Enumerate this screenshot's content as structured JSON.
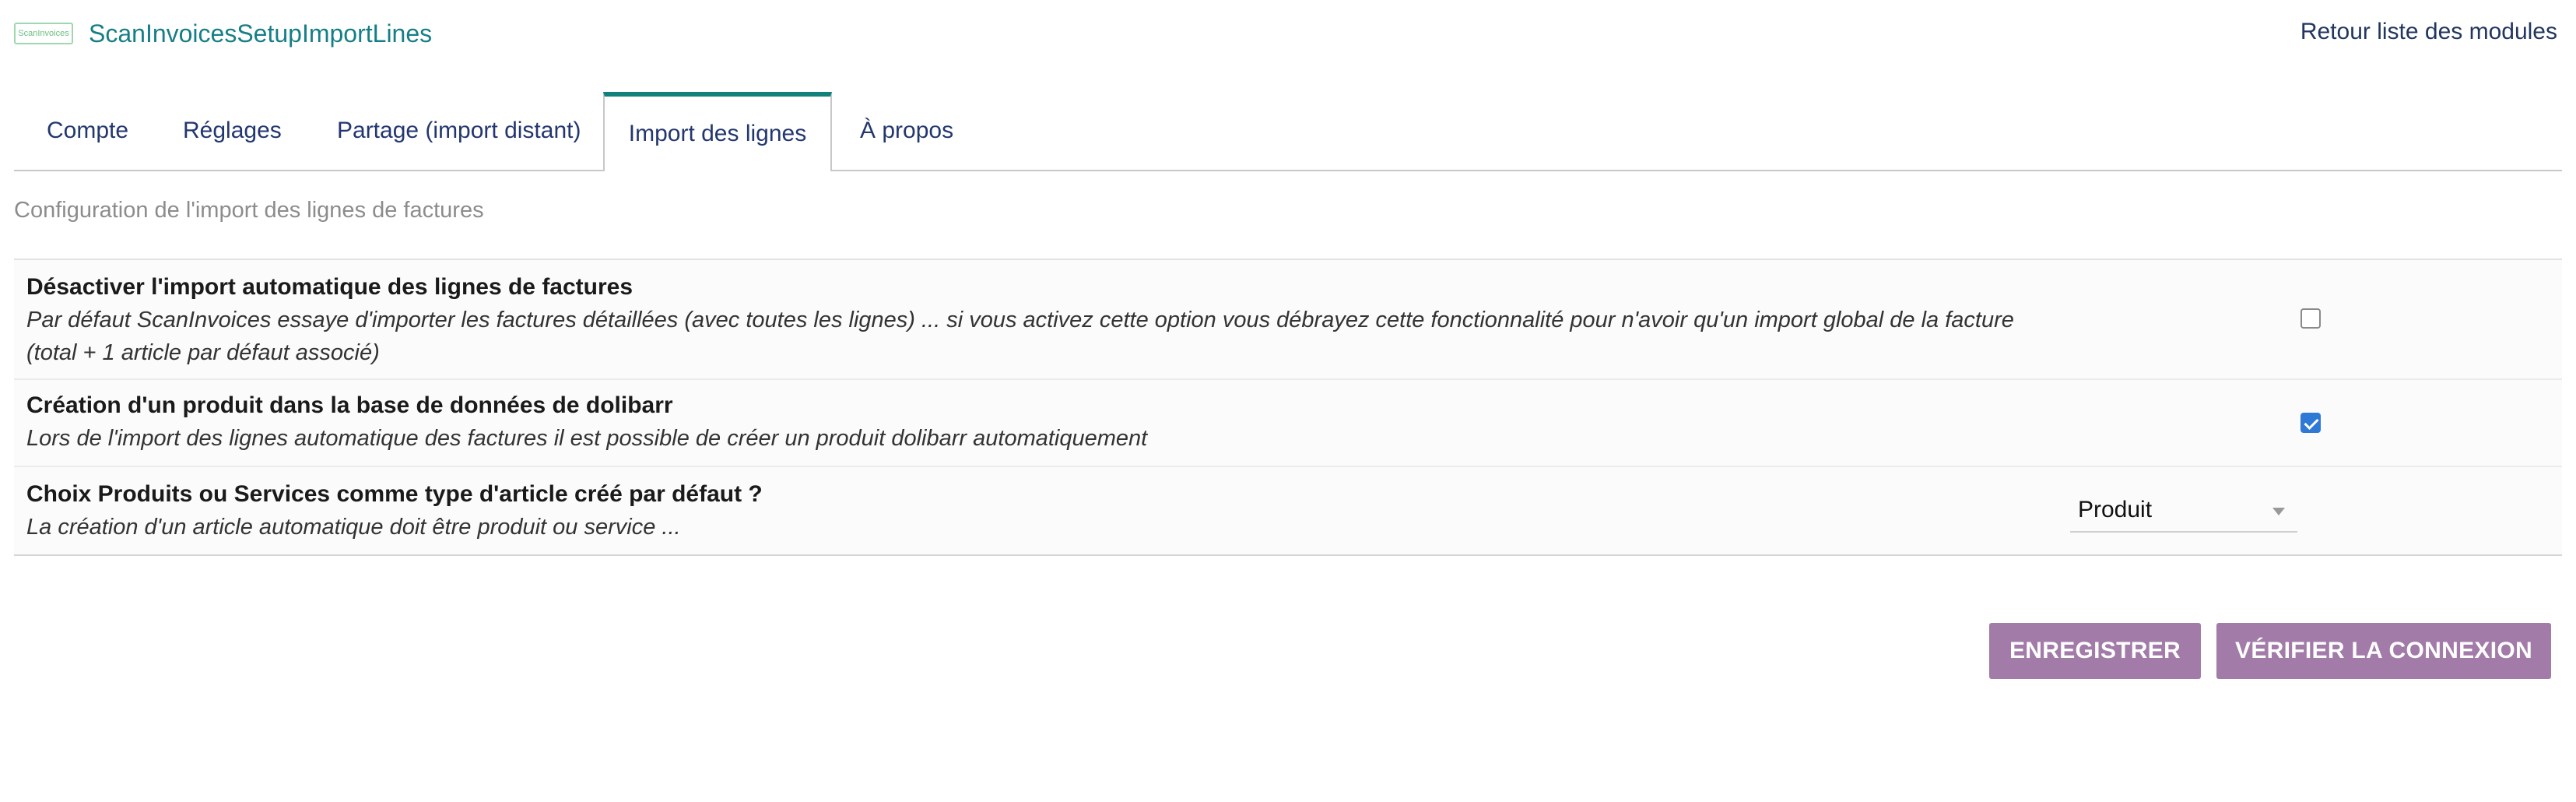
{
  "header": {
    "logo_text": "ScanInvoices",
    "title": "ScanInvoicesSetupImportLines",
    "back_link": "Retour liste des modules"
  },
  "tabs": [
    {
      "label": "Compte",
      "active": false
    },
    {
      "label": "Réglages",
      "active": false
    },
    {
      "label": "Partage (import distant)",
      "active": false
    },
    {
      "label": "Import des lignes",
      "active": true
    },
    {
      "label": "À propos",
      "active": false
    }
  ],
  "subtitle": "Configuration de l'import des lignes de factures",
  "rows": [
    {
      "label": "Désactiver l'import automatique des lignes de factures",
      "desc": "Par défaut ScanInvoices essaye d'importer les factures détaillées (avec toutes les lignes) ... si vous activez cette option vous débrayez cette fonctionnalité pour n'avoir qu'un import global de la facture (total + 1 article par défaut associé)",
      "checked": false
    },
    {
      "label": "Création d'un produit dans la base de données de dolibarr",
      "desc": "Lors de l'import des lignes automatique des factures il est possible de créer un produit dolibarr automatiquement",
      "checked": true
    },
    {
      "label": "Choix Produits ou Services comme type d'article créé par défaut ?",
      "desc": "La création d'un article automatique doit être produit ou service ...",
      "select_value": "Produit"
    }
  ],
  "buttons": {
    "save": "ENREGISTRER",
    "verify": "VÉRIFIER LA CONNEXION"
  },
  "colors": {
    "accent": "#12807b",
    "button": "#a27ba9",
    "link": "#23376f",
    "checkbox_checked": "#2f79d6"
  }
}
